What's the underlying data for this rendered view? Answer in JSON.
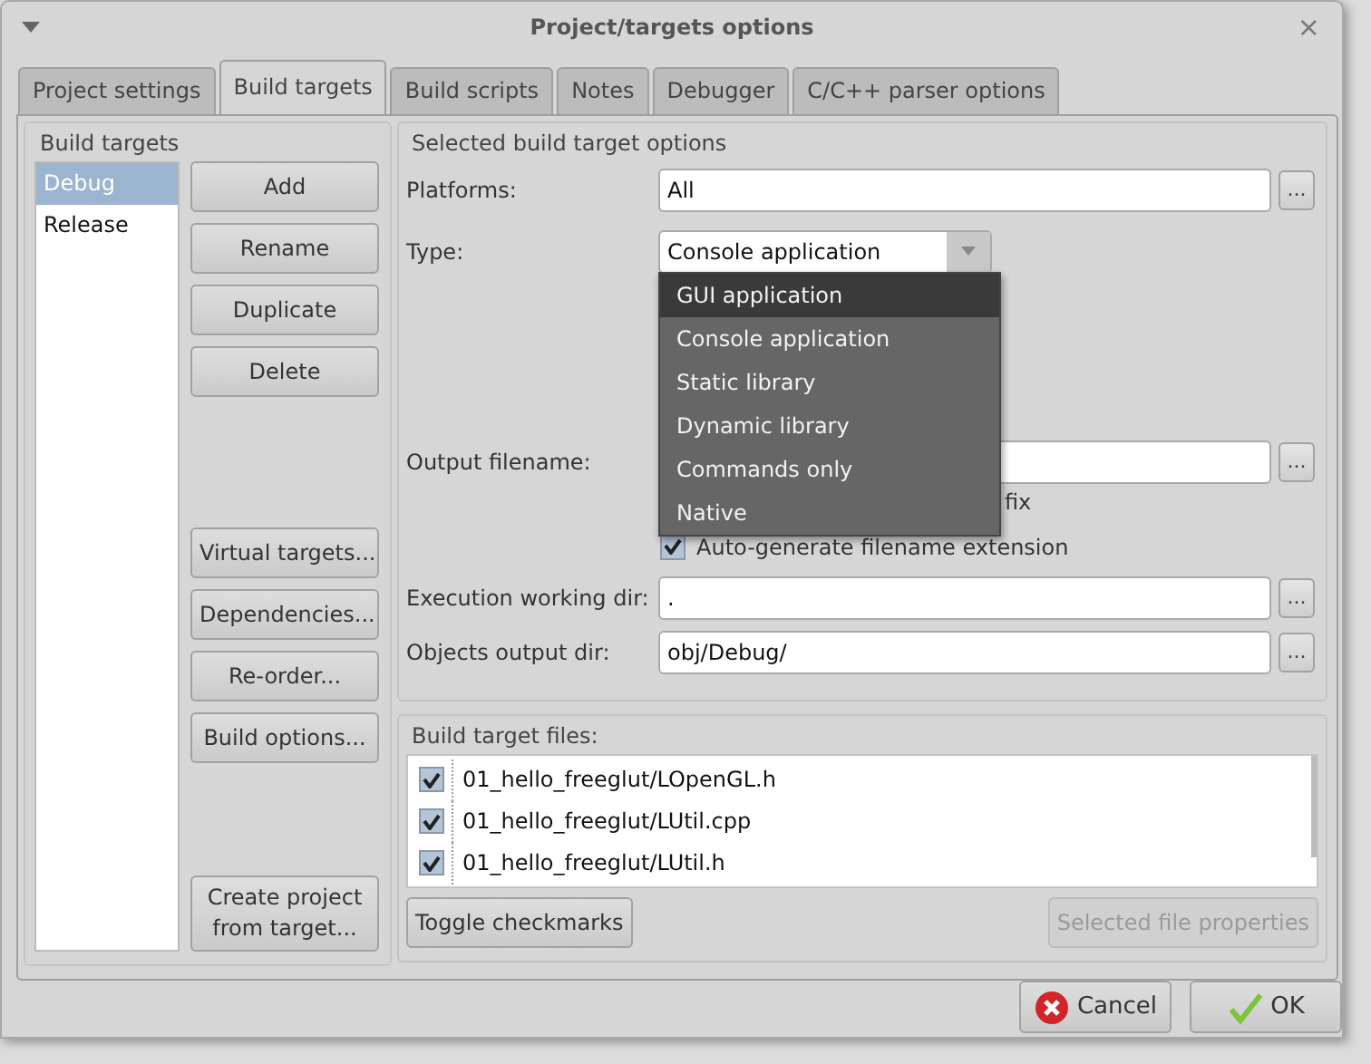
{
  "window": {
    "title": "Project/targets options",
    "close": "×"
  },
  "tabs": [
    {
      "label": "Project settings",
      "selected": false
    },
    {
      "label": "Build targets",
      "selected": true
    },
    {
      "label": "Build scripts",
      "selected": false
    },
    {
      "label": "Notes",
      "selected": false
    },
    {
      "label": "Debugger",
      "selected": false
    },
    {
      "label": "C/C++ parser options",
      "selected": false
    }
  ],
  "build_targets": {
    "title": "Build targets",
    "items": [
      {
        "label": "Debug",
        "selected": true
      },
      {
        "label": "Release",
        "selected": false
      }
    ],
    "top_buttons": [
      "Add",
      "Rename",
      "Duplicate",
      "Delete"
    ],
    "lower_buttons": [
      "Virtual targets...",
      "Dependencies...",
      "Re-order...",
      "Build options..."
    ],
    "create_button": "Create project from target..."
  },
  "options": {
    "title": "Selected build target options",
    "platforms": {
      "label": "Platforms:",
      "value": "All",
      "browse": "..."
    },
    "type": {
      "label": "Type:",
      "value": "Console application"
    },
    "type_menu": [
      {
        "label": "GUI application",
        "selected": true
      },
      {
        "label": "Console application",
        "selected": false
      },
      {
        "label": "Static library",
        "selected": false
      },
      {
        "label": "Dynamic library",
        "selected": false
      },
      {
        "label": "Commands only",
        "selected": false
      },
      {
        "label": "Native",
        "selected": false
      }
    ],
    "output_filename": {
      "label": "Output filename:",
      "browse": "..."
    },
    "covered_label_end": "fix",
    "auto_extension": {
      "label": "Auto-generate filename extension",
      "checked": true
    },
    "exec_dir": {
      "label": "Execution working dir:",
      "value": ".",
      "browse": "..."
    },
    "objects_dir": {
      "label": "Objects output dir:",
      "value": "obj/Debug/",
      "browse": "..."
    }
  },
  "files": {
    "title": "Build target files:",
    "items": [
      {
        "name": "01_hello_freeglut/LOpenGL.h",
        "checked": true
      },
      {
        "name": "01_hello_freeglut/LUtil.cpp",
        "checked": true
      },
      {
        "name": "01_hello_freeglut/LUtil.h",
        "checked": true
      }
    ],
    "toggle_button": "Toggle checkmarks",
    "properties_button": {
      "label": "Selected file properties",
      "disabled": true
    }
  },
  "buttons": [
    {
      "label": "Cancel",
      "kind": "cancel"
    },
    {
      "label": "OK",
      "kind": "ok"
    }
  ]
}
